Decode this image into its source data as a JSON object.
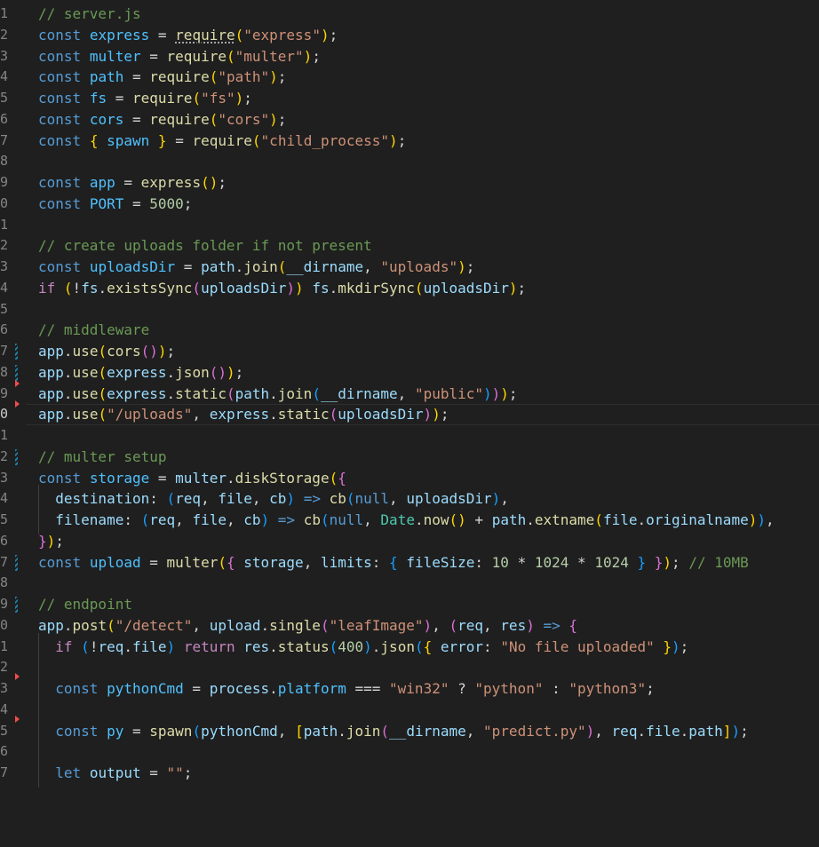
{
  "editor": {
    "file_comment": "// server.js",
    "lines": [
      {
        "num": "1",
        "text": "// server.js"
      },
      {
        "num": "2",
        "text": "const express = require(\"express\");"
      },
      {
        "num": "3",
        "text": "const multer = require(\"multer\");"
      },
      {
        "num": "4",
        "text": "const path = require(\"path\");"
      },
      {
        "num": "5",
        "text": "const fs = require(\"fs\");"
      },
      {
        "num": "6",
        "text": "const cors = require(\"cors\");"
      },
      {
        "num": "7",
        "text": "const { spawn } = require(\"child_process\");"
      },
      {
        "num": "8",
        "text": ""
      },
      {
        "num": "9",
        "text": "const app = express();"
      },
      {
        "num": "0",
        "text": "const PORT = 5000;"
      },
      {
        "num": "1",
        "text": ""
      },
      {
        "num": "2",
        "text": "// create uploads folder if not present"
      },
      {
        "num": "3",
        "text": "const uploadsDir = path.join(__dirname, \"uploads\");"
      },
      {
        "num": "4",
        "text": "if (!fs.existsSync(uploadsDir)) fs.mkdirSync(uploadsDir);"
      },
      {
        "num": "5",
        "text": ""
      },
      {
        "num": "6",
        "text": "// middleware"
      },
      {
        "num": "7",
        "text": "app.use(cors());"
      },
      {
        "num": "8",
        "text": "app.use(express.json());"
      },
      {
        "num": "9",
        "text": "app.use(express.static(path.join(__dirname, \"public\")));"
      },
      {
        "num": "0",
        "text": "app.use(\"/uploads\", express.static(uploadsDir));"
      },
      {
        "num": "1",
        "text": ""
      },
      {
        "num": "2",
        "text": "// multer setup"
      },
      {
        "num": "3",
        "text": "const storage = multer.diskStorage({"
      },
      {
        "num": "4",
        "text": "  destination: (req, file, cb) => cb(null, uploadsDir),"
      },
      {
        "num": "5",
        "text": "  filename: (req, file, cb) => cb(null, Date.now() + path.extname(file.originalname)),"
      },
      {
        "num": "6",
        "text": "});"
      },
      {
        "num": "7",
        "text": "const upload = multer({ storage, limits: { fileSize: 10 * 1024 * 1024 } }); // 10MB"
      },
      {
        "num": "8",
        "text": ""
      },
      {
        "num": "9",
        "text": "// endpoint"
      },
      {
        "num": "0",
        "text": "app.post(\"/detect\", upload.single(\"leafImage\"), (req, res) => {"
      },
      {
        "num": "1",
        "text": "  if (!req.file) return res.status(400).json({ error: \"No file uploaded\" });"
      },
      {
        "num": "2",
        "text": ""
      },
      {
        "num": "3",
        "text": "  const pythonCmd = process.platform === \"win32\" ? \"python\" : \"python3\";"
      },
      {
        "num": "4",
        "text": ""
      },
      {
        "num": "5",
        "text": "  const py = spawn(pythonCmd, [path.join(__dirname, \"predict.py\"), req.file.path]);"
      },
      {
        "num": "6",
        "text": ""
      },
      {
        "num": "7",
        "text": "  let output = \"\";"
      }
    ]
  },
  "colors": {
    "background": "#1f1f1f",
    "keyword": "#569cd6",
    "control_keyword": "#c586c0",
    "variable": "#9cdcfe",
    "constant": "#4fc1ff",
    "function": "#dcdcaa",
    "string": "#ce9178",
    "number": "#b5cea8",
    "comment": "#6a9955",
    "type": "#4ec9b0",
    "line_number": "#858585",
    "modified_gutter": "#1b81a8",
    "deleted_gutter": "#f14c4c"
  }
}
